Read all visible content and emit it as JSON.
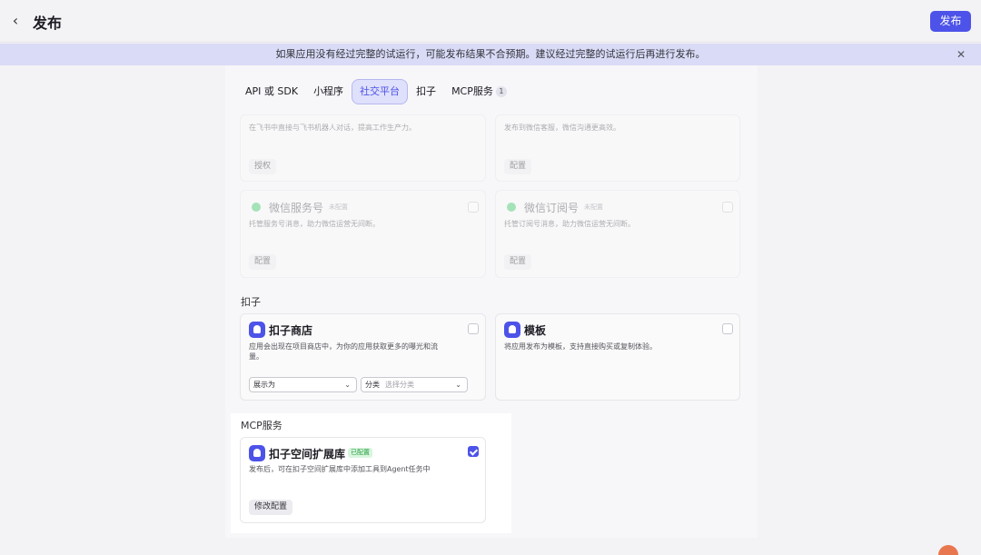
{
  "header": {
    "back_label": "‹",
    "title": "发布",
    "publish_label": "发布"
  },
  "notice": {
    "text": "如果应用没有经过完整的试运行，可能发布结果不合预期。建议经过完整的试运行后再进行发布。",
    "close_label": "✕"
  },
  "tabs": [
    {
      "label": "API 或 SDK"
    },
    {
      "label": "小程序"
    },
    {
      "label": "社交平台",
      "active": true
    },
    {
      "label": "扣子"
    },
    {
      "label": "MCP服务",
      "badge": "1"
    }
  ],
  "social": {
    "feishu": {
      "desc": "在飞书中直接与飞书机器人对话，提高工作生产力。",
      "button": "授权"
    },
    "wechat_kf": {
      "desc": "发布到微信客服，微信沟通更高效。",
      "button": "配置"
    },
    "wechat_service": {
      "title": "微信服务号",
      "status": "未配置",
      "desc": "托管服务号消息，助力微信运营无间断。",
      "button": "配置"
    },
    "wechat_sub": {
      "title": "微信订阅号",
      "status": "未配置",
      "desc": "托管订阅号消息，助力微信运营无间断。",
      "button": "配置"
    }
  },
  "kouzi": {
    "section_label": "扣子",
    "store": {
      "title": "扣子商店",
      "desc_line1": "应用会出现在项目商店中，为你的应用获取更多的曝光和流",
      "desc_line2": "量。",
      "select_display": "展示为",
      "select_category_label": "分类",
      "select_category_placeholder": "选择分类"
    },
    "template": {
      "title": "模板",
      "desc": "将应用发布为模板，支持直接购买或复制体验。"
    }
  },
  "mcp": {
    "section_label": "MCP服务",
    "card": {
      "title": "扣子空间扩展库",
      "status": "已配置",
      "desc": "发布后，可在扣子空间扩展库中添加工具到Agent任务中",
      "button": "修改配置",
      "checked": true
    }
  },
  "colors": {
    "accent": "#4d53e8",
    "notice_bg": "#d9dbf7",
    "success": "#239c41"
  }
}
